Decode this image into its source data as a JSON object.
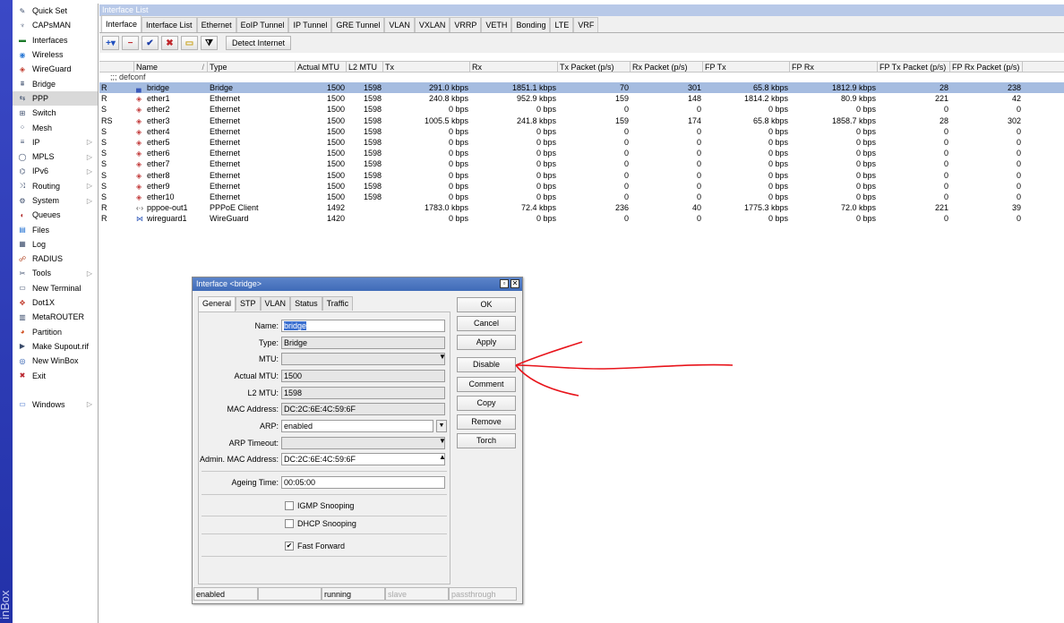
{
  "brand": "inBox",
  "sidebar": {
    "items": [
      {
        "label": "Quick Set",
        "icon": "wand-icon",
        "arrow": false
      },
      {
        "label": "CAPsMAN",
        "icon": "antenna-icon",
        "arrow": false
      },
      {
        "label": "Interfaces",
        "icon": "interfaces-icon",
        "arrow": false
      },
      {
        "label": "Wireless",
        "icon": "wireless-icon",
        "arrow": false
      },
      {
        "label": "WireGuard",
        "icon": "wireguard-icon",
        "arrow": false
      },
      {
        "label": "Bridge",
        "icon": "bridge-icon",
        "arrow": false
      },
      {
        "label": "PPP",
        "icon": "ppp-icon",
        "arrow": false
      },
      {
        "label": "Switch",
        "icon": "switch-icon",
        "arrow": false
      },
      {
        "label": "Mesh",
        "icon": "mesh-icon",
        "arrow": false
      },
      {
        "label": "IP",
        "icon": "ip-icon",
        "arrow": true
      },
      {
        "label": "MPLS",
        "icon": "mpls-icon",
        "arrow": true
      },
      {
        "label": "IPv6",
        "icon": "ipv6-icon",
        "arrow": true
      },
      {
        "label": "Routing",
        "icon": "routing-icon",
        "arrow": true
      },
      {
        "label": "System",
        "icon": "system-icon",
        "arrow": true
      },
      {
        "label": "Queues",
        "icon": "queues-icon",
        "arrow": false
      },
      {
        "label": "Files",
        "icon": "files-icon",
        "arrow": false
      },
      {
        "label": "Log",
        "icon": "log-icon",
        "arrow": false
      },
      {
        "label": "RADIUS",
        "icon": "radius-icon",
        "arrow": false
      },
      {
        "label": "Tools",
        "icon": "tools-icon",
        "arrow": true
      },
      {
        "label": "New Terminal",
        "icon": "terminal-icon",
        "arrow": false
      },
      {
        "label": "Dot1X",
        "icon": "dot1x-icon",
        "arrow": false
      },
      {
        "label": "MetaROUTER",
        "icon": "metarouter-icon",
        "arrow": false
      },
      {
        "label": "Partition",
        "icon": "partition-icon",
        "arrow": false
      },
      {
        "label": "Make Supout.rif",
        "icon": "supout-icon",
        "arrow": false
      },
      {
        "label": "New WinBox",
        "icon": "winbox-icon",
        "arrow": false
      },
      {
        "label": "Exit",
        "icon": "exit-icon",
        "arrow": false
      }
    ],
    "windows": {
      "label": "Windows",
      "icon": "windows-icon",
      "arrow": true
    }
  },
  "main": {
    "title": "Interface List",
    "tabs": [
      "Interface",
      "Interface List",
      "Ethernet",
      "EoIP Tunnel",
      "IP Tunnel",
      "GRE Tunnel",
      "VLAN",
      "VXLAN",
      "VRRP",
      "VETH",
      "Bonding",
      "LTE",
      "VRF"
    ],
    "toolbar": {
      "detect_label": "Detect Internet"
    },
    "columns": [
      "",
      "Name",
      "Type",
      "Actual MTU",
      "L2 MTU",
      "Tx",
      "Rx",
      "Tx Packet (p/s)",
      "Rx Packet (p/s)",
      "FP Tx",
      "FP Rx",
      "FP Tx Packet (p/s)",
      "FP Rx Packet (p/s)"
    ],
    "sort_marker": "/",
    "comment": ";;; defconf",
    "rows": [
      [
        "R",
        "bridge",
        "Bridge",
        "1500",
        "1598",
        "291.0 kbps",
        "1851.1 kbps",
        "70",
        "301",
        "65.8 kbps",
        "1812.9 kbps",
        "28",
        "238"
      ],
      [
        "R",
        "ether1",
        "Ethernet",
        "1500",
        "1598",
        "240.8 kbps",
        "952.9 kbps",
        "159",
        "148",
        "1814.2 kbps",
        "80.9 kbps",
        "221",
        "42"
      ],
      [
        "S",
        "ether2",
        "Ethernet",
        "1500",
        "1598",
        "0 bps",
        "0 bps",
        "0",
        "0",
        "0 bps",
        "0 bps",
        "0",
        "0"
      ],
      [
        "RS",
        "ether3",
        "Ethernet",
        "1500",
        "1598",
        "1005.5 kbps",
        "241.8 kbps",
        "159",
        "174",
        "65.8 kbps",
        "1858.7 kbps",
        "28",
        "302"
      ],
      [
        "S",
        "ether4",
        "Ethernet",
        "1500",
        "1598",
        "0 bps",
        "0 bps",
        "0",
        "0",
        "0 bps",
        "0 bps",
        "0",
        "0"
      ],
      [
        "S",
        "ether5",
        "Ethernet",
        "1500",
        "1598",
        "0 bps",
        "0 bps",
        "0",
        "0",
        "0 bps",
        "0 bps",
        "0",
        "0"
      ],
      [
        "S",
        "ether6",
        "Ethernet",
        "1500",
        "1598",
        "0 bps",
        "0 bps",
        "0",
        "0",
        "0 bps",
        "0 bps",
        "0",
        "0"
      ],
      [
        "S",
        "ether7",
        "Ethernet",
        "1500",
        "1598",
        "0 bps",
        "0 bps",
        "0",
        "0",
        "0 bps",
        "0 bps",
        "0",
        "0"
      ],
      [
        "S",
        "ether8",
        "Ethernet",
        "1500",
        "1598",
        "0 bps",
        "0 bps",
        "0",
        "0",
        "0 bps",
        "0 bps",
        "0",
        "0"
      ],
      [
        "S",
        "ether9",
        "Ethernet",
        "1500",
        "1598",
        "0 bps",
        "0 bps",
        "0",
        "0",
        "0 bps",
        "0 bps",
        "0",
        "0"
      ],
      [
        "S",
        "ether10",
        "Ethernet",
        "1500",
        "1598",
        "0 bps",
        "0 bps",
        "0",
        "0",
        "0 bps",
        "0 bps",
        "0",
        "0"
      ],
      [
        "R",
        "pppoe-out1",
        "PPPoE Client",
        "1492",
        "",
        "1783.0 kbps",
        "72.4 kbps",
        "236",
        "40",
        "1775.3 kbps",
        "72.0 kbps",
        "221",
        "39"
      ],
      [
        "R",
        "wireguard1",
        "WireGuard",
        "1420",
        "",
        "0 bps",
        "0 bps",
        "0",
        "0",
        "0 bps",
        "0 bps",
        "0",
        "0"
      ]
    ],
    "row_icons": [
      "bridge-icon",
      "ethernet-icon",
      "ethernet-icon",
      "ethernet-icon",
      "ethernet-icon",
      "ethernet-icon",
      "ethernet-icon",
      "ethernet-icon",
      "ethernet-icon",
      "ethernet-icon",
      "ethernet-icon",
      "pppoe-icon",
      "wireguard-icon"
    ]
  },
  "dialog": {
    "title": "Interface <bridge>",
    "tabs": [
      "General",
      "STP",
      "VLAN",
      "Status",
      "Traffic"
    ],
    "fields": {
      "name_label": "Name:",
      "name": "bridge",
      "type_label": "Type:",
      "type": "Bridge",
      "mtu_label": "MTU:",
      "mtu": "",
      "actual_mtu_label": "Actual MTU:",
      "actual_mtu": "1500",
      "l2mtu_label": "L2 MTU:",
      "l2mtu": "1598",
      "mac_label": "MAC Address:",
      "mac": "DC:2C:6E:4C:59:6F",
      "arp_label": "ARP:",
      "arp": "enabled",
      "arp_timeout_label": "ARP Timeout:",
      "arp_timeout": "",
      "admin_mac_label": "Admin. MAC Address:",
      "admin_mac": "DC:2C:6E:4C:59:6F",
      "ageing_label": "Ageing Time:",
      "ageing": "00:05:00"
    },
    "checkboxes": {
      "igmp": {
        "label": "IGMP Snooping",
        "checked": false
      },
      "dhcp": {
        "label": "DHCP Snooping",
        "checked": false
      },
      "ff": {
        "label": "Fast Forward",
        "checked": true
      }
    },
    "buttons": [
      "OK",
      "Cancel",
      "Apply",
      "Disable",
      "Comment",
      "Copy",
      "Remove",
      "Torch"
    ],
    "status": [
      "enabled",
      "",
      "running",
      "slave",
      "passthrough"
    ]
  },
  "annotation_color": "#e8141b"
}
